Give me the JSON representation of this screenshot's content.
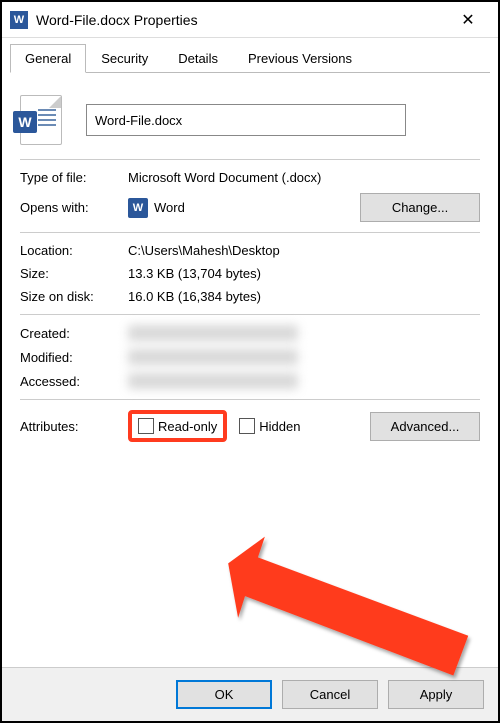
{
  "window": {
    "title": "Word-File.docx Properties"
  },
  "tabs": {
    "general": "General",
    "security": "Security",
    "details": "Details",
    "prev": "Previous Versions"
  },
  "file": {
    "name": "Word-File.docx"
  },
  "labels": {
    "type": "Type of file:",
    "opens": "Opens with:",
    "location": "Location:",
    "size": "Size:",
    "sizeondisk": "Size on disk:",
    "created": "Created:",
    "modified": "Modified:",
    "accessed": "Accessed:",
    "attributes": "Attributes:"
  },
  "values": {
    "type": "Microsoft Word Document (.docx)",
    "opens_app": "Word",
    "location": "C:\\Users\\Mahesh\\Desktop",
    "size": "13.3 KB (13,704 bytes)",
    "sizeondisk": "16.0 KB (16,384 bytes)"
  },
  "attributes": {
    "readonly_label": "Read-only",
    "hidden_label": "Hidden"
  },
  "buttons": {
    "change": "Change...",
    "advanced": "Advanced...",
    "ok": "OK",
    "cancel": "Cancel",
    "apply": "Apply"
  }
}
